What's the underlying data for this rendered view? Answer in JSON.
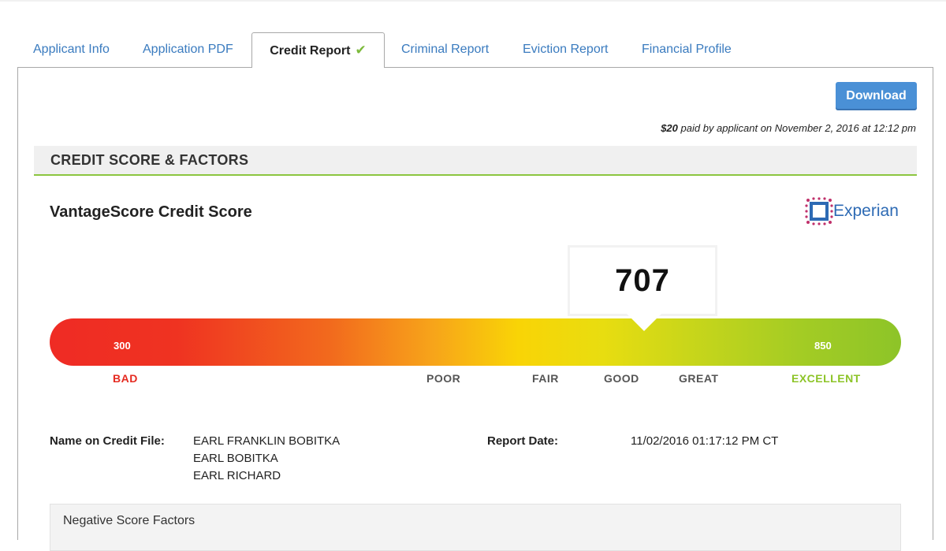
{
  "tabs": [
    {
      "label": "Applicant Info",
      "active": false
    },
    {
      "label": "Application PDF",
      "active": false
    },
    {
      "label": "Credit Report",
      "active": true,
      "check": "✔"
    },
    {
      "label": "Criminal Report",
      "active": false
    },
    {
      "label": "Eviction Report",
      "active": false
    },
    {
      "label": "Financial Profile",
      "active": false
    }
  ],
  "header": {
    "download_label": "Download",
    "paid_amount": "$20",
    "paid_text": " paid by applicant on November 2, 2016 at 12:12 pm"
  },
  "section": {
    "title": "CREDIT SCORE & FACTORS"
  },
  "score": {
    "title": "VantageScore Credit Score",
    "provider": "Experian",
    "value": "707",
    "min_label": "300",
    "max_label": "850",
    "ratings": [
      "BAD",
      "POOR",
      "FAIR",
      "GOOD",
      "GREAT",
      "EXCELLENT"
    ]
  },
  "details": {
    "name_label": "Name on Credit File:",
    "names": [
      "EARL FRANKLIN BOBITKA",
      "EARL BOBITKA",
      "EARL RICHARD"
    ],
    "report_date_label": "Report Date:",
    "report_date": "11/02/2016 01:17:12 PM CT"
  },
  "negative_factors": {
    "title": "Negative Score Factors"
  },
  "colors": {
    "accent_blue": "#4a90d6",
    "tab_link": "#3a7bbf",
    "green": "#8dc428",
    "red": "#e52a20",
    "experian_blue": "#2d6ab4",
    "experian_pink": "#c0306a"
  },
  "icons": {
    "tab_check": "check-icon",
    "experian_logo": "experian-logo-icon"
  }
}
